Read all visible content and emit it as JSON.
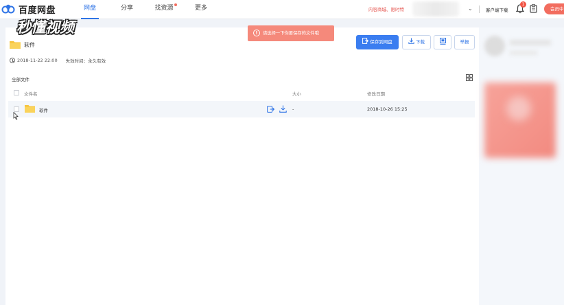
{
  "app": {
    "logo_text": "百度网盘",
    "nav": [
      {
        "label": "网盘",
        "active": true
      },
      {
        "label": "分享",
        "active": false
      },
      {
        "label": "找资源",
        "active": false,
        "dot": true
      },
      {
        "label": "更多",
        "active": false
      }
    ],
    "promo_text": "内容商城、限时特",
    "client_download": "客户端下载",
    "notification_count": "1",
    "member_label": "会员中"
  },
  "watermark": "秒懂视频",
  "toast": {
    "icon": "!",
    "message": "请选择一下你要保存的文件哦"
  },
  "share": {
    "title": "软件",
    "created": "2018-11-22 22:00",
    "expire_label": "失效时间：永久有效"
  },
  "actions": {
    "save_label": "保存到网盘",
    "download_label": "下载",
    "report_label": "举报"
  },
  "list": {
    "breadcrumb": "全部文件",
    "columns": {
      "name": "文件名",
      "size": "大小",
      "date": "修改日期"
    },
    "rows": [
      {
        "name": "软件",
        "size": "-",
        "date": "2018-10-26 15:25"
      }
    ]
  },
  "colors": {
    "accent": "#2f74e6",
    "toast": "#f5897b",
    "member": "#f26d5f",
    "folder": "#f7c33b"
  }
}
